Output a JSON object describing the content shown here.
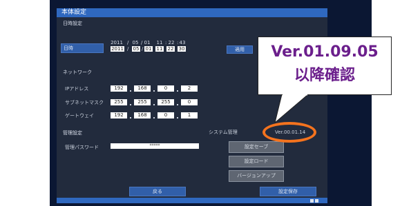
{
  "window": {
    "title": "本体設定"
  },
  "datetime": {
    "section_label": "日時設定",
    "timezone_button": "日時",
    "current": {
      "year": "2011",
      "month": "05",
      "day": "01",
      "hour": "11",
      "minute": "22",
      "second": "43"
    },
    "set": {
      "year": "2011",
      "month": "05",
      "day": "01",
      "hour": "11",
      "minute": "22",
      "second": "30"
    },
    "apply_button": "適用"
  },
  "network": {
    "section_label": "ネットワーク",
    "ip_label": "IPアドレス",
    "ip": [
      "192",
      "168",
      "0",
      "2"
    ],
    "subnet_label": "サブネットマスク",
    "subnet": [
      "255",
      "255",
      "255",
      "0"
    ],
    "gateway_label": "ゲートウェイ",
    "gateway": [
      "192",
      "168",
      "0",
      "1"
    ]
  },
  "admin": {
    "section_label": "管理設定",
    "password_label": "管理パスワード",
    "password_value": "*****"
  },
  "system": {
    "section_label": "システム管理",
    "version": "Ver.00.01.14",
    "save_button": "設定セーブ",
    "load_button": "設定ロード",
    "update_button": "バージョンアップ"
  },
  "footer": {
    "back_button": "戻る",
    "save_settings_button": "設定保存"
  },
  "callout": {
    "line1": "Ver.01.09.05",
    "line2": "以降確認",
    "text_color": "#6b1f8c",
    "highlight_color": "#f4731e"
  }
}
